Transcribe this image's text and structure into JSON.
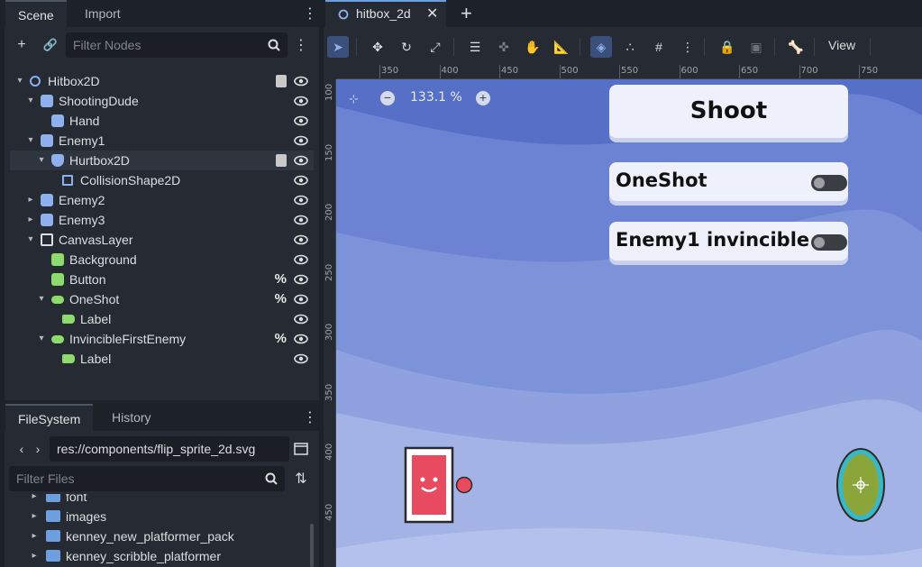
{
  "scene_dock": {
    "tabs": [
      {
        "label": "Scene"
      },
      {
        "label": "Import"
      }
    ],
    "filter_placeholder": "Filter Nodes",
    "tree": [
      {
        "label": "Hitbox2D",
        "icon": "node2d-icon",
        "arrow": "▾",
        "script": true,
        "pct": "",
        "indent": 0
      },
      {
        "label": "ShootingDude",
        "icon": "character-icon",
        "arrow": "▾",
        "script": false,
        "pct": "",
        "indent": 1
      },
      {
        "label": "Hand",
        "icon": "character-icon",
        "arrow": "",
        "script": false,
        "pct": "",
        "indent": 2
      },
      {
        "label": "Enemy1",
        "icon": "character-icon",
        "arrow": "▾",
        "script": false,
        "pct": "",
        "indent": 1
      },
      {
        "label": "Hurtbox2D",
        "icon": "shield-icon",
        "arrow": "▾",
        "script": true,
        "pct": "",
        "indent": 2,
        "selected": true
      },
      {
        "label": "CollisionShape2D",
        "icon": "collision-shape-icon",
        "arrow": "",
        "script": false,
        "pct": "",
        "indent": 3
      },
      {
        "label": "Enemy2",
        "icon": "character-icon",
        "arrow": "▸",
        "script": false,
        "pct": "",
        "indent": 1
      },
      {
        "label": "Enemy3",
        "icon": "character-icon",
        "arrow": "▸",
        "script": false,
        "pct": "",
        "indent": 1
      },
      {
        "label": "CanvasLayer",
        "icon": "canvas-layer-icon",
        "arrow": "▾",
        "script": false,
        "pct": "",
        "indent": 1
      },
      {
        "label": "Background",
        "icon": "texture-rect-icon",
        "arrow": "",
        "script": false,
        "pct": "",
        "indent": 2
      },
      {
        "label": "Button",
        "icon": "button-icon",
        "arrow": "",
        "script": false,
        "pct": "%",
        "indent": 2
      },
      {
        "label": "OneShot",
        "icon": "check-button-icon",
        "arrow": "▾",
        "script": false,
        "pct": "%",
        "indent": 2
      },
      {
        "label": "Label",
        "icon": "label-icon",
        "arrow": "",
        "script": false,
        "pct": "",
        "indent": 3
      },
      {
        "label": "InvincibleFirstEnemy",
        "icon": "check-button-icon",
        "arrow": "▾",
        "script": false,
        "pct": "%",
        "indent": 2
      },
      {
        "label": "Label",
        "icon": "label-icon",
        "arrow": "",
        "script": false,
        "pct": "",
        "indent": 3
      }
    ]
  },
  "filesystem_dock": {
    "tabs": [
      {
        "label": "FileSystem"
      },
      {
        "label": "History"
      }
    ],
    "path": "res://components/flip_sprite_2d.svg",
    "filter_placeholder": "Filter Files",
    "items": [
      {
        "label": "font"
      },
      {
        "label": "images"
      },
      {
        "label": "kenney_new_platformer_pack"
      },
      {
        "label": "kenney_scribble_platformer"
      }
    ]
  },
  "editor": {
    "scene_tab": "hitbox_2d",
    "view_menu": "View",
    "zoom": "133.1 %",
    "ruler_h": [
      "350",
      "400",
      "450",
      "500",
      "550",
      "600",
      "650",
      "700",
      "750"
    ],
    "ruler_v": [
      "100",
      "150",
      "200",
      "250",
      "300",
      "350",
      "400",
      "450"
    ]
  },
  "game_ui": {
    "shoot_label": "Shoot",
    "oneshot_label": "OneShot",
    "invincible_label": "Enemy1 invincible",
    "oneshot_on": false,
    "invincible_on": false
  },
  "colors": {
    "accent": "#6d9ee0",
    "sky": "#5670c8",
    "enemy_red": "#e84a5f",
    "player_green": "#8aa63a"
  }
}
